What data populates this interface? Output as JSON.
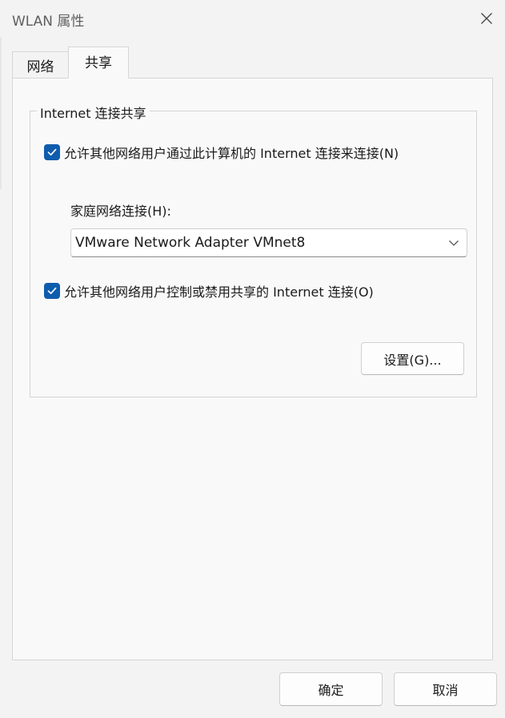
{
  "window": {
    "title": "WLAN 属性"
  },
  "tabs": [
    {
      "label": "网络",
      "selected": false
    },
    {
      "label": "共享",
      "selected": true
    }
  ],
  "group": {
    "legend": "Internet 连接共享",
    "allow_share_label": "允许其他网络用户通过此计算机的 Internet 连接来连接(N)",
    "allow_share_checked": true,
    "home_network_label": "家庭网络连接(H):",
    "home_network_value": "VMware Network Adapter VMnet8",
    "allow_control_label": "允许其他网络用户控制或禁用共享的 Internet 连接(O)",
    "allow_control_checked": true,
    "settings_button": "设置(G)..."
  },
  "footer": {
    "ok_label": "确定",
    "cancel_label": "取消"
  },
  "colors": {
    "accent": "#0f5cad",
    "window_bg": "#f3f3f3",
    "panel_bg": "#f9f9f9"
  },
  "icons": {
    "close": "close-icon",
    "checkbox": "checkmark-icon",
    "dropdown": "chevron-down-icon"
  }
}
